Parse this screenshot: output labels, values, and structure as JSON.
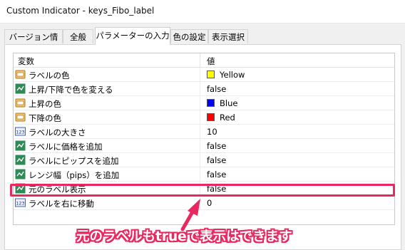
{
  "window": {
    "title": "Custom Indicator - keys_Fibo_label"
  },
  "tabs": [
    {
      "label": "バージョン情報"
    },
    {
      "label": "全般"
    },
    {
      "label": "パラメーターの入力"
    },
    {
      "label": "色の設定"
    },
    {
      "label": "表示選択"
    }
  ],
  "active_tab": 2,
  "table": {
    "col_variable": "変数",
    "col_value": "値",
    "rows": [
      {
        "name": "ラベルの色",
        "value": "Yellow",
        "icon": "color-icon",
        "color": "#ffff00"
      },
      {
        "name": "上昇/下降で色を変える",
        "value": "false",
        "icon": "bool-icon"
      },
      {
        "name": "上昇の色",
        "value": "Blue",
        "icon": "color-icon",
        "color": "#0000ff"
      },
      {
        "name": "下降の色",
        "value": "Red",
        "icon": "color-icon",
        "color": "#ff0000"
      },
      {
        "name": "ラベルの大きさ",
        "value": "10",
        "icon": "number-icon"
      },
      {
        "name": "ラベルに価格を追加",
        "value": "false",
        "icon": "bool-icon"
      },
      {
        "name": "ラベルにピップスを追加",
        "value": "false",
        "icon": "bool-icon"
      },
      {
        "name": "レンジ幅（pips）を追加",
        "value": "false",
        "icon": "bool-icon"
      },
      {
        "name": "元のラベル表示",
        "value": "false",
        "icon": "bool-icon"
      },
      {
        "name": "ラベルを右に移動",
        "value": "0",
        "icon": "number-icon"
      }
    ]
  },
  "annotation": {
    "text": "元のラベルもtrueで表示はできます",
    "color": "#e8285f"
  }
}
